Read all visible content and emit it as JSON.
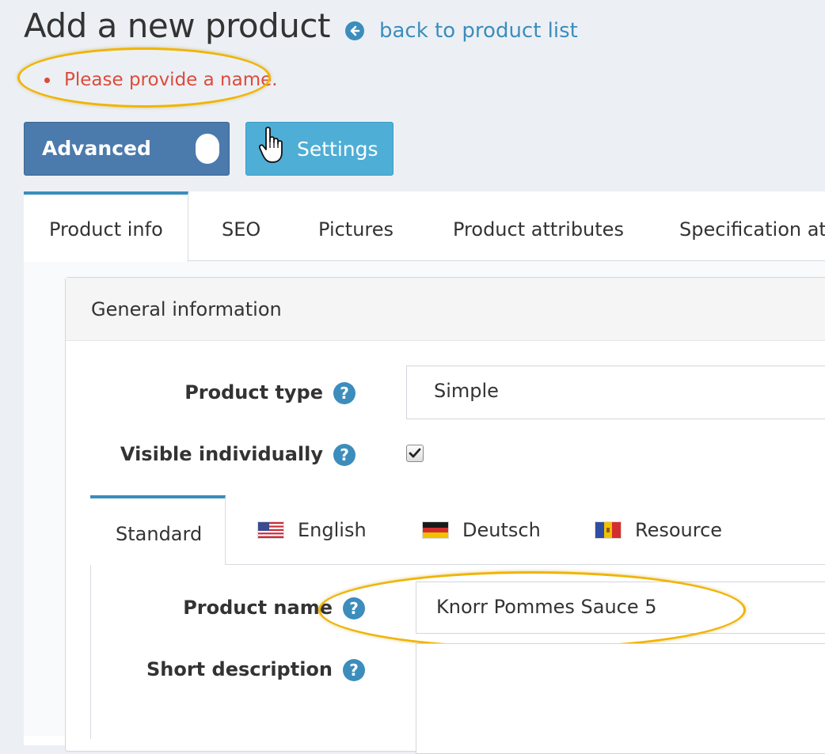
{
  "header": {
    "title": "Add a new product",
    "back_link": "back to product list"
  },
  "errors": [
    "Please provide a name."
  ],
  "toolbar": {
    "advanced_label": "Advanced",
    "settings_label": "Settings"
  },
  "main_tabs": [
    {
      "label": "Product info",
      "active": true
    },
    {
      "label": "SEO"
    },
    {
      "label": "Pictures"
    },
    {
      "label": "Product attributes"
    },
    {
      "label": "Specification attributes"
    }
  ],
  "general_info": {
    "title": "General information",
    "product_type": {
      "label": "Product type",
      "value": "Simple"
    },
    "visible_individually": {
      "label": "Visible individually",
      "checked": true
    }
  },
  "language_tabs": [
    {
      "label": "Standard",
      "active": true
    },
    {
      "label": "English",
      "flag": "us-flag-icon"
    },
    {
      "label": "Deutsch",
      "flag": "de-flag-icon"
    },
    {
      "label": "Resource",
      "flag": "md-flag-icon"
    }
  ],
  "localized": {
    "product_name": {
      "label": "Product name",
      "value": "Knorr Pommes Sauce 5"
    },
    "short_description": {
      "label": "Short description",
      "value": ""
    }
  },
  "help_glyph": "?",
  "colors": {
    "accent": "#3c8dbc",
    "error": "#dd4b39",
    "advanced_button": "#4b7aad",
    "settings_button": "#4eaed6",
    "highlight": "#f0b400"
  }
}
